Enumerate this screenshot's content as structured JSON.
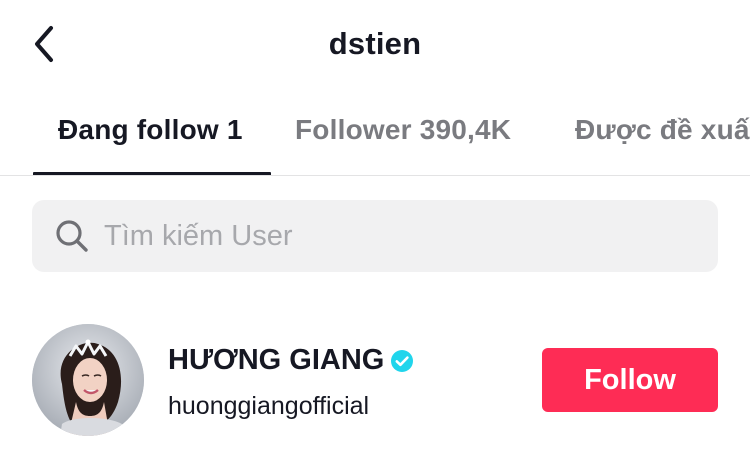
{
  "header": {
    "back_icon": "chevron-left-icon",
    "title": "dstien"
  },
  "tabs": [
    {
      "label": "Đang follow 1",
      "active": true
    },
    {
      "label": "Follower 390,4K",
      "active": false
    },
    {
      "label": "Được đề xuất",
      "active": false
    }
  ],
  "search": {
    "icon": "search-icon",
    "placeholder": "Tìm kiếm User",
    "value": ""
  },
  "users": [
    {
      "display_name": "HƯƠNG GIANG",
      "verified": true,
      "handle": "huonggiangofficial",
      "follow_label": "Follow"
    }
  ],
  "colors": {
    "accent": "#fe2c55",
    "verified": "#20d5ec",
    "text_primary": "#161823",
    "text_secondary": "#7a7b80",
    "search_bg": "#f1f1f2"
  }
}
